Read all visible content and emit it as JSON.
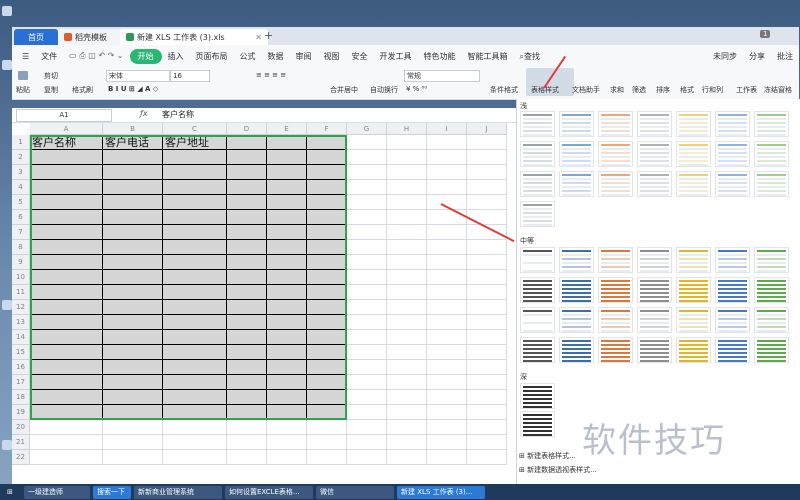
{
  "tabs": [
    {
      "label": "首页"
    },
    {
      "label": "稻壳模板"
    },
    {
      "label": "新建 XLS 工作表 (3).xls"
    }
  ],
  "menus": [
    "文件",
    "开始",
    "插入",
    "页面布局",
    "公式",
    "数据",
    "审阅",
    "视图",
    "安全",
    "开发工具",
    "特色功能",
    "智能工具箱",
    "查找"
  ],
  "window_right": {
    "sync": "未同步",
    "share": "分享",
    "batch": "批注",
    "page": "1"
  },
  "ribbon": {
    "paste": "粘贴",
    "cut": "剪切",
    "copy": "复制",
    "format_brush": "格式刷",
    "font": "宋体",
    "size": "16",
    "format": "常规",
    "merge": "合并居中",
    "wrap": "自动换行",
    "cond_format": "条件格式",
    "table_style": "表格样式",
    "doc_helper": "文档助手",
    "sum": "求和",
    "filter": "筛选",
    "sort": "排序",
    "format2": "格式",
    "rowcol": "行和列",
    "sheet": "工作表",
    "freeze": "冻结窗格"
  },
  "namebox": "A1",
  "formula": "客户名称",
  "columns": [
    "A",
    "B",
    "C",
    "D",
    "E",
    "F",
    "G",
    "H",
    "I",
    "J"
  ],
  "rows": [
    "1",
    "2",
    "3",
    "4",
    "5",
    "6",
    "7",
    "8",
    "9",
    "10",
    "11",
    "12",
    "13",
    "14",
    "15",
    "16",
    "17",
    "18",
    "19",
    "20",
    "21",
    "22"
  ],
  "headers": [
    "客户名称",
    "客户电话",
    "客户地址"
  ],
  "panel": {
    "light": "浅",
    "medium": "中等",
    "dark": "深",
    "new_style": "新建表格样式...",
    "new_pivot": "新建数据透视表样式..."
  },
  "taskbar": [
    {
      "label": "一级建造师"
    },
    {
      "label": "搜索一下"
    },
    {
      "label": "新新商业管理系统"
    },
    {
      "label": "如何设置EXCLE表格..."
    },
    {
      "label": "微信"
    },
    {
      "label": "新建 XLS 工作表 (3)..."
    }
  ],
  "watermark": "软件技巧",
  "colors": {
    "accent": "#2bb673",
    "selection": "#2fa34c",
    "header_tab": "#2a6fd6",
    "arrow": "#e23b3b"
  }
}
